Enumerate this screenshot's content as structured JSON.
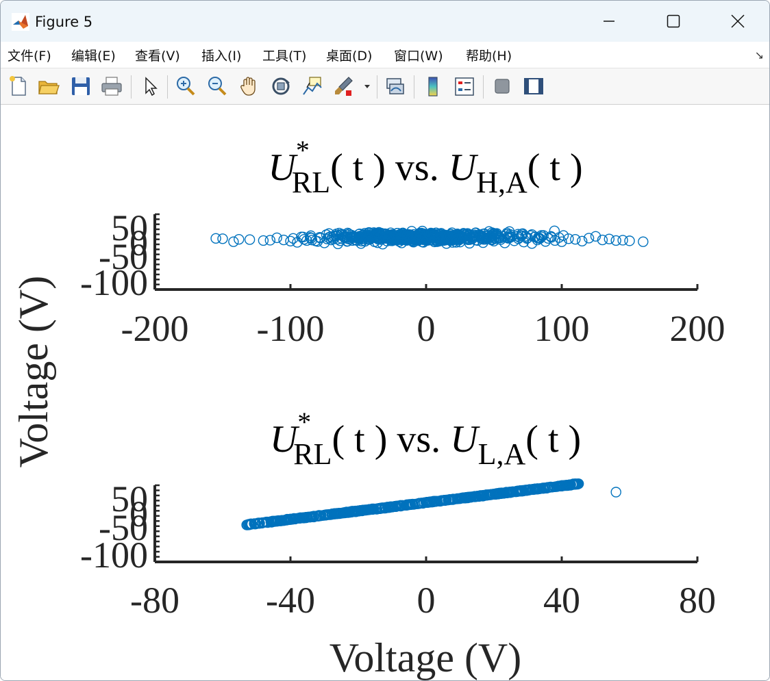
{
  "window": {
    "title": "Figure 5",
    "icons": [
      "matlab-logo",
      "minimize-icon",
      "maximize-icon",
      "close-icon"
    ]
  },
  "menu": [
    "文件(F)",
    "编辑(E)",
    "查看(V)",
    "插入(I)",
    "工具(T)",
    "桌面(D)",
    "窗口(W)",
    "帮助(H)"
  ],
  "toolbar": {
    "icons": [
      "new-figure-icon",
      "open-file-icon",
      "save-icon",
      "print-icon",
      "select-arrow-icon",
      "zoom-in-icon",
      "zoom-out-icon",
      "pan-hand-icon",
      "rotate-3d-icon",
      "data-cursor-icon",
      "brush-icon",
      "brush-dropdown-icon",
      "link-plot-icon",
      "colorbar-icon",
      "legend-icon",
      "hide-plot-tools-icon",
      "show-plot-tools-icon"
    ]
  },
  "colors": {
    "marker": "#0072bd",
    "axis": "#262626"
  },
  "figure": {
    "ylabel": "Voltage (V)",
    "xlabel": "Voltage (V)"
  },
  "chart_data": [
    {
      "type": "scatter",
      "title": {
        "U": "U",
        "star": "*",
        "RL": "RL",
        "mid": "( t ) vs. ",
        "U2": "U",
        "sub2": "H,A",
        "end": "( t )"
      },
      "title_text": "U*RL( t ) vs. UH,A( t )",
      "xlim": [
        -200,
        200
      ],
      "ylim": [
        -100,
        50
      ],
      "xticks": [
        "-200",
        "-100",
        "0",
        "100",
        "200"
      ],
      "yticks": [
        "-100",
        "-50",
        "0",
        "50"
      ],
      "ytick_labels_shown": [
        "50",
        "0",
        "-50",
        "-100"
      ],
      "marker": "open-circle",
      "series": [
        {
          "description_points": [
            [
              -155,
              3
            ],
            [
              -150,
              2
            ],
            [
              -142,
              -8
            ],
            [
              -138,
              0
            ],
            [
              -130,
              -1
            ],
            [
              -120,
              -4
            ],
            [
              -115,
              -3
            ],
            [
              -110,
              5
            ],
            [
              -105,
              -2
            ],
            [
              -100,
              -6
            ],
            [
              -98,
              3
            ],
            [
              -95,
              -10
            ],
            [
              -92,
              8
            ],
            [
              -90,
              0
            ],
            [
              -88,
              -4
            ],
            [
              -85,
              12
            ],
            [
              -80,
              -7
            ],
            [
              -78,
              4
            ],
            [
              -75,
              -12
            ],
            [
              -72,
              6
            ],
            [
              -70,
              -2
            ],
            [
              -68,
              10
            ],
            [
              -65,
              -15
            ],
            [
              -62,
              2
            ],
            [
              -60,
              8
            ],
            [
              -58,
              -6
            ],
            [
              -55,
              14
            ],
            [
              -52,
              -3
            ],
            [
              -50,
              5
            ],
            [
              -48,
              -14
            ],
            [
              -45,
              9
            ],
            [
              -42,
              -1
            ],
            [
              -40,
              12
            ],
            [
              -38,
              -8
            ],
            [
              -35,
              3
            ],
            [
              -32,
              -16
            ],
            [
              -30,
              7
            ],
            [
              -28,
              15
            ],
            [
              -25,
              -5
            ],
            [
              -22,
              1
            ],
            [
              -20,
              10
            ],
            [
              -18,
              -12
            ],
            [
              -15,
              4
            ],
            [
              -12,
              13
            ],
            [
              -10,
              -7
            ],
            [
              -8,
              2
            ],
            [
              -5,
              11
            ],
            [
              -2,
              -10
            ],
            [
              0,
              6
            ],
            [
              2,
              -3
            ],
            [
              5,
              16
            ],
            [
              8,
              -8
            ],
            [
              10,
              3
            ],
            [
              12,
              12
            ],
            [
              15,
              -14
            ],
            [
              18,
              5
            ],
            [
              20,
              -2
            ],
            [
              22,
              10
            ],
            [
              25,
              -9
            ],
            [
              28,
              14
            ],
            [
              30,
              0
            ],
            [
              32,
              -13
            ],
            [
              35,
              8
            ],
            [
              38,
              -4
            ],
            [
              40,
              13
            ],
            [
              42,
              -11
            ],
            [
              45,
              4
            ],
            [
              48,
              9
            ],
            [
              50,
              -6
            ],
            [
              52,
              15
            ],
            [
              55,
              -1
            ],
            [
              58,
              -12
            ],
            [
              60,
              7
            ],
            [
              62,
              16
            ],
            [
              65,
              -5
            ],
            [
              68,
              2
            ],
            [
              70,
              11
            ],
            [
              72,
              -9
            ],
            [
              75,
              5
            ],
            [
              78,
              -14
            ],
            [
              80,
              8
            ],
            [
              82,
              -2
            ],
            [
              85,
              13
            ],
            [
              88,
              -7
            ],
            [
              90,
              3
            ],
            [
              92,
              10
            ],
            [
              95,
              -4
            ],
            [
              98,
              6
            ],
            [
              100,
              -8
            ],
            [
              105,
              2
            ],
            [
              110,
              0
            ],
            [
              115,
              -6
            ],
            [
              120,
              4
            ],
            [
              125,
              10
            ],
            [
              130,
              -2
            ],
            [
              135,
              1
            ],
            [
              140,
              -4
            ],
            [
              145,
              -3
            ],
            [
              150,
              -5
            ],
            [
              160,
              -8
            ]
          ]
        }
      ]
    },
    {
      "type": "scatter",
      "title": {
        "U": "U",
        "star": "*",
        "RL": "RL",
        "mid": "( t ) vs. ",
        "U2": "U",
        "sub2": "L,A",
        "end": "( t )"
      },
      "title_text": "U*RL( t ) vs. UL,A( t )",
      "xlim": [
        -80,
        80
      ],
      "ylim": [
        -100,
        50
      ],
      "xticks": [
        "-80",
        "-40",
        "0",
        "40",
        "80"
      ],
      "yticks": [
        "-100",
        "-50",
        "0",
        "50"
      ],
      "ytick_labels_shown": [
        "50",
        "0",
        "-50",
        "-100"
      ],
      "marker": "open-circle",
      "series": [
        {
          "trend": "linear",
          "x_range": [
            -53,
            55
          ],
          "approx_line": {
            "slope": 0.82,
            "intercept": 0
          },
          "outlier": [
            56,
            50
          ]
        }
      ]
    }
  ]
}
